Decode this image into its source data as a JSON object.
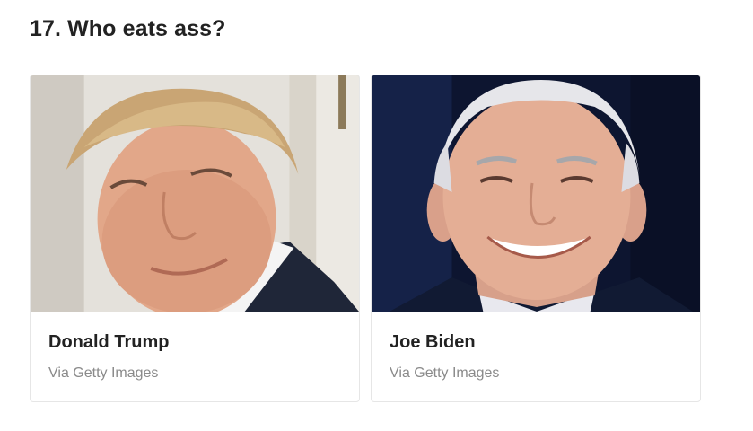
{
  "question": {
    "title": "17. Who eats ass?"
  },
  "answers": [
    {
      "name": "Donald Trump",
      "credit": "Via Getty Images",
      "photo_icon": "portrait-photo"
    },
    {
      "name": "Joe Biden",
      "credit": "Via Getty Images",
      "photo_icon": "portrait-photo"
    }
  ]
}
